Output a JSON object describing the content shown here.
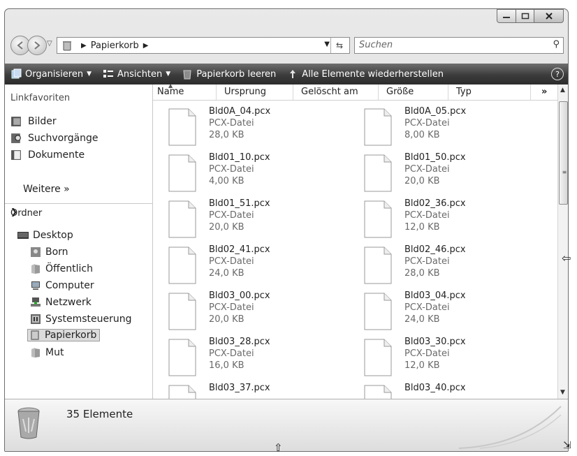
{
  "window": {
    "caption_buttons": {
      "minimize": "minimize-icon",
      "maximize": "maximize-icon",
      "close": "close-icon"
    }
  },
  "address": {
    "crumb": "Papierkorb",
    "search_placeholder": "Suchen"
  },
  "toolbar": {
    "organize": "Organisieren",
    "views": "Ansichten",
    "empty_bin": "Papierkorb leeren",
    "restore_all": "Alle Elemente wiederherstellen",
    "help": "?"
  },
  "nav": {
    "header": "Linkfavoriten",
    "links": [
      {
        "label": "Bilder",
        "icon": "pictures-icon"
      },
      {
        "label": "Suchvorgänge",
        "icon": "searches-icon"
      },
      {
        "label": "Dokumente",
        "icon": "documents-icon"
      }
    ],
    "more": "Weitere  »",
    "folders_header": "Ordner",
    "tree": [
      {
        "label": "Desktop",
        "icon": "desktop-icon"
      },
      {
        "label": "Born",
        "icon": "user-icon"
      },
      {
        "label": "Öffentlich",
        "icon": "folder-icon"
      },
      {
        "label": "Computer",
        "icon": "computer-icon"
      },
      {
        "label": "Netzwerk",
        "icon": "network-icon"
      },
      {
        "label": "Systemsteuerung",
        "icon": "control-panel-icon"
      },
      {
        "label": "Papierkorb",
        "icon": "recycle-bin-icon"
      },
      {
        "label": "Mut",
        "icon": "folder-icon"
      }
    ]
  },
  "columns": [
    "Name",
    "Ursprung",
    "Gelöscht am",
    "Größe",
    "Typ",
    "»"
  ],
  "files": [
    {
      "name": "Bld0A_04.pcx",
      "type": "PCX-Datei",
      "size": "28,0 KB"
    },
    {
      "name": "Bld0A_05.pcx",
      "type": "PCX-Datei",
      "size": "8,00 KB"
    },
    {
      "name": "Bld01_10.pcx",
      "type": "PCX-Datei",
      "size": "4,00 KB"
    },
    {
      "name": "Bld01_50.pcx",
      "type": "PCX-Datei",
      "size": "20,0 KB"
    },
    {
      "name": "Bld01_51.pcx",
      "type": "PCX-Datei",
      "size": "20,0 KB"
    },
    {
      "name": "Bld02_36.pcx",
      "type": "PCX-Datei",
      "size": "12,0 KB"
    },
    {
      "name": "Bld02_41.pcx",
      "type": "PCX-Datei",
      "size": "24,0 KB"
    },
    {
      "name": "Bld02_46.pcx",
      "type": "PCX-Datei",
      "size": "28,0 KB"
    },
    {
      "name": "Bld03_00.pcx",
      "type": "PCX-Datei",
      "size": "20,0 KB"
    },
    {
      "name": "Bld03_04.pcx",
      "type": "PCX-Datei",
      "size": "24,0 KB"
    },
    {
      "name": "Bld03_28.pcx",
      "type": "PCX-Datei",
      "size": "16,0 KB"
    },
    {
      "name": "Bld03_30.pcx",
      "type": "PCX-Datei",
      "size": "12,0 KB"
    },
    {
      "name": "Bld03_37.pcx",
      "type": "",
      "size": ""
    },
    {
      "name": "Bld03_40.pcx",
      "type": "",
      "size": ""
    }
  ],
  "status": {
    "count": "35 Elemente"
  }
}
